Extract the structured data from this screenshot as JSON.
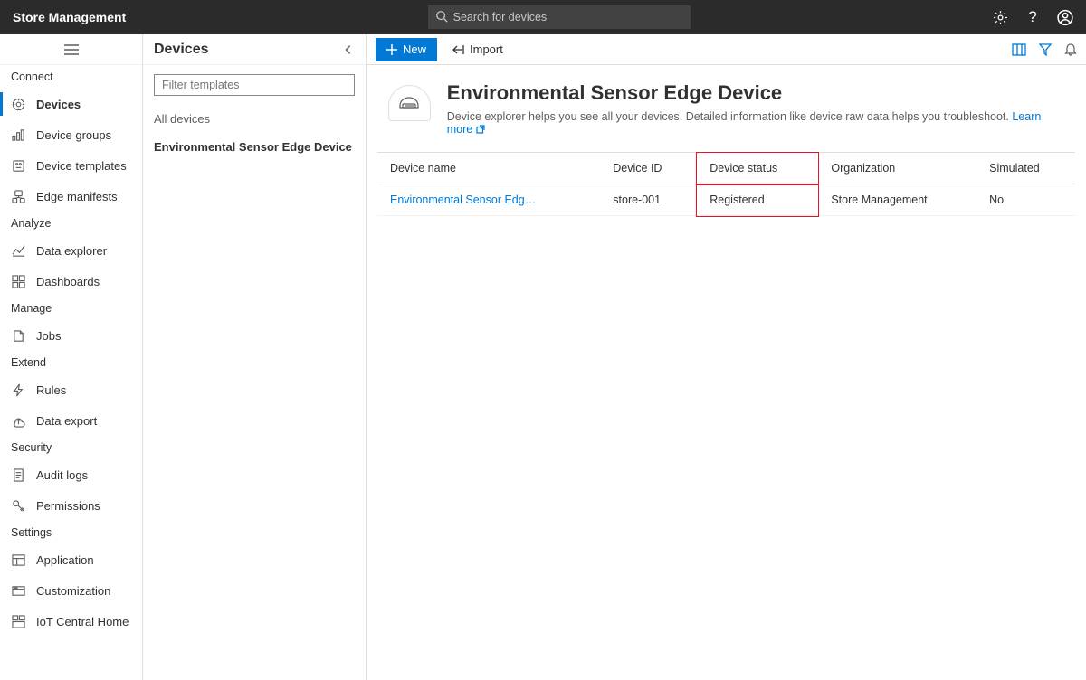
{
  "app": {
    "title": "Store Management"
  },
  "search": {
    "placeholder": "Search for devices"
  },
  "nav": {
    "sections": [
      {
        "header": "Connect",
        "items": [
          {
            "key": "devices",
            "label": "Devices",
            "active": true
          },
          {
            "key": "device-groups",
            "label": "Device groups"
          },
          {
            "key": "device-templates",
            "label": "Device templates"
          },
          {
            "key": "edge-manifests",
            "label": "Edge manifests"
          }
        ]
      },
      {
        "header": "Analyze",
        "items": [
          {
            "key": "data-explorer",
            "label": "Data explorer"
          },
          {
            "key": "dashboards",
            "label": "Dashboards"
          }
        ]
      },
      {
        "header": "Manage",
        "items": [
          {
            "key": "jobs",
            "label": "Jobs"
          }
        ]
      },
      {
        "header": "Extend",
        "items": [
          {
            "key": "rules",
            "label": "Rules"
          },
          {
            "key": "data-export",
            "label": "Data export"
          }
        ]
      },
      {
        "header": "Security",
        "items": [
          {
            "key": "audit-logs",
            "label": "Audit logs"
          },
          {
            "key": "permissions",
            "label": "Permissions"
          }
        ]
      },
      {
        "header": "Settings",
        "items": [
          {
            "key": "application",
            "label": "Application"
          },
          {
            "key": "customization",
            "label": "Customization"
          },
          {
            "key": "iot-central-home",
            "label": "IoT Central Home"
          }
        ]
      }
    ]
  },
  "templates": {
    "heading": "Devices",
    "filter_placeholder": "Filter templates",
    "items": [
      {
        "label": "All devices",
        "selected": false
      },
      {
        "label": "Environmental Sensor Edge Device",
        "selected": true
      }
    ]
  },
  "commands": {
    "new": "New",
    "import": "Import"
  },
  "page": {
    "title": "Environmental Sensor Edge Device",
    "subtitle": "Device explorer helps you see all your devices. Detailed information like device raw data helps you troubleshoot. ",
    "learn_more": "Learn more"
  },
  "table": {
    "columns": [
      "Device name",
      "Device ID",
      "Device status",
      "Organization",
      "Simulated"
    ],
    "rows": [
      {
        "name": "Environmental Sensor Edg…",
        "id": "store-001",
        "status": "Registered",
        "org": "Store Management",
        "sim": "No"
      }
    ]
  }
}
